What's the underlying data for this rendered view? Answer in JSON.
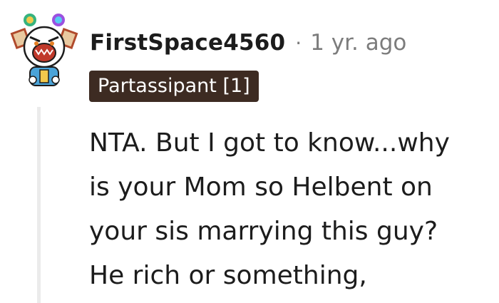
{
  "comment": {
    "username": "FirstSpace4560",
    "separator": "·",
    "timestamp": "1 yr. ago",
    "flair": "Partassipant [1]",
    "avatar_icon": "snoo-avatar-icon",
    "body_lines": [
      "NTA. But I got to know...why",
      "is your Mom so Helbent on",
      "your sis marrying this guy?",
      "He rich or something,"
    ]
  },
  "colors": {
    "flair_background": "#3d2b22",
    "flair_text": "#ffffff",
    "username_text": "#1c1c1c",
    "meta_text": "#7c7c7c",
    "thread_line": "#ebebeb"
  }
}
